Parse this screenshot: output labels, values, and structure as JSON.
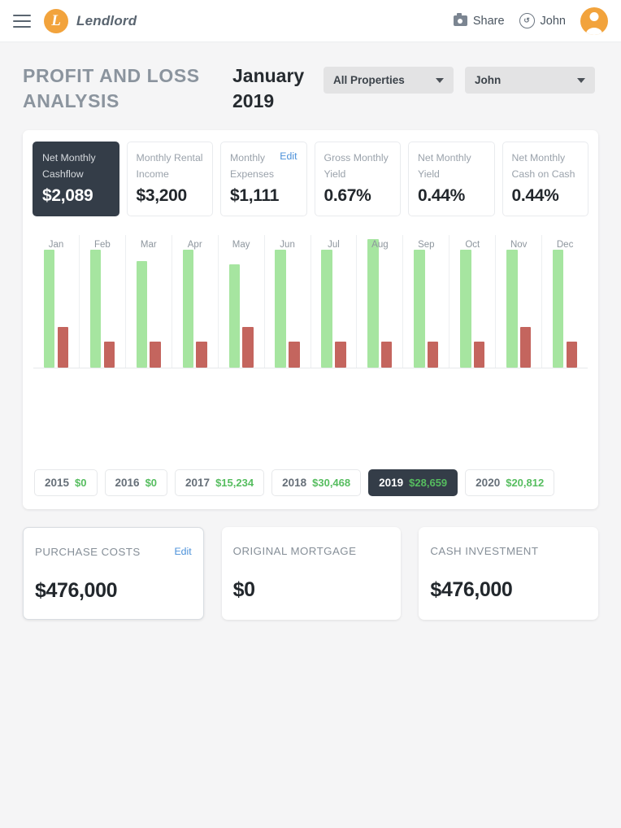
{
  "topbar": {
    "menu_icon": "hamburger-icon",
    "brand": "Lendlord",
    "logo_letter": "L",
    "share_label": "Share",
    "share_icon": "camera-icon",
    "user_label": "John",
    "user_icon": "switch-account-icon",
    "avatar_icon": "user-avatar"
  },
  "header": {
    "title": "PROFIT AND LOSS ANALYSIS",
    "period": "January 2019",
    "property_select": "All Properties",
    "user_select": "John"
  },
  "kpis": [
    {
      "label": "Net Monthly Cashflow",
      "value": "$2,089",
      "active": true,
      "edit": ""
    },
    {
      "label": "Monthly Rental Income",
      "value": "$3,200",
      "active": false,
      "edit": ""
    },
    {
      "label": "Monthly Expenses",
      "value": "$1,111",
      "active": false,
      "edit": "Edit"
    },
    {
      "label": "Gross Monthly Yield",
      "value": "0.67%",
      "active": false,
      "edit": ""
    },
    {
      "label": "Net Monthly Yield",
      "value": "0.44%",
      "active": false,
      "edit": ""
    },
    {
      "label": "Net Monthly Cash on Cash",
      "value": "0.44%",
      "active": false,
      "edit": ""
    }
  ],
  "chart_data": {
    "type": "bar",
    "title": "",
    "xlabel": "",
    "ylabel": "",
    "grid": false,
    "legend": "none",
    "categories": [
      "Jan",
      "Feb",
      "Mar",
      "Apr",
      "May",
      "Jun",
      "Jul",
      "Aug",
      "Sep",
      "Oct",
      "Nov",
      "Dec"
    ],
    "ylim": [
      0,
      3600
    ],
    "series": [
      {
        "name": "Income",
        "color": "#a6e5a0",
        "values": [
          3200,
          3200,
          2900,
          3200,
          2800,
          3200,
          3200,
          3500,
          3200,
          3200,
          3200,
          3200
        ]
      },
      {
        "name": "Expenses",
        "color": "#c4655e",
        "values": [
          1111,
          700,
          700,
          700,
          1111,
          700,
          700,
          700,
          700,
          700,
          1111,
          700
        ]
      }
    ]
  },
  "years": [
    {
      "year": "2015",
      "value": "$0",
      "active": false
    },
    {
      "year": "2016",
      "value": "$0",
      "active": false
    },
    {
      "year": "2017",
      "value": "$15,234",
      "active": false
    },
    {
      "year": "2018",
      "value": "$30,468",
      "active": false
    },
    {
      "year": "2019",
      "value": "$28,659",
      "active": true
    },
    {
      "year": "2020",
      "value": "$20,812",
      "active": false
    }
  ],
  "bottom_cards": [
    {
      "label": "PURCHASE COSTS",
      "value": "$476,000",
      "edit": "Edit",
      "outlined": true
    },
    {
      "label": "ORIGINAL MORTGAGE",
      "value": "$0",
      "edit": "",
      "outlined": false
    },
    {
      "label": "CASH INVESTMENT",
      "value": "$476,000",
      "edit": "",
      "outlined": false
    }
  ],
  "colors": {
    "accent_orange": "#f2a33c",
    "dark_panel": "#343d48",
    "income_green": "#a6e5a0",
    "expense_red": "#c4655e",
    "value_green": "#56bd5f",
    "link_blue": "#4a90d9"
  }
}
